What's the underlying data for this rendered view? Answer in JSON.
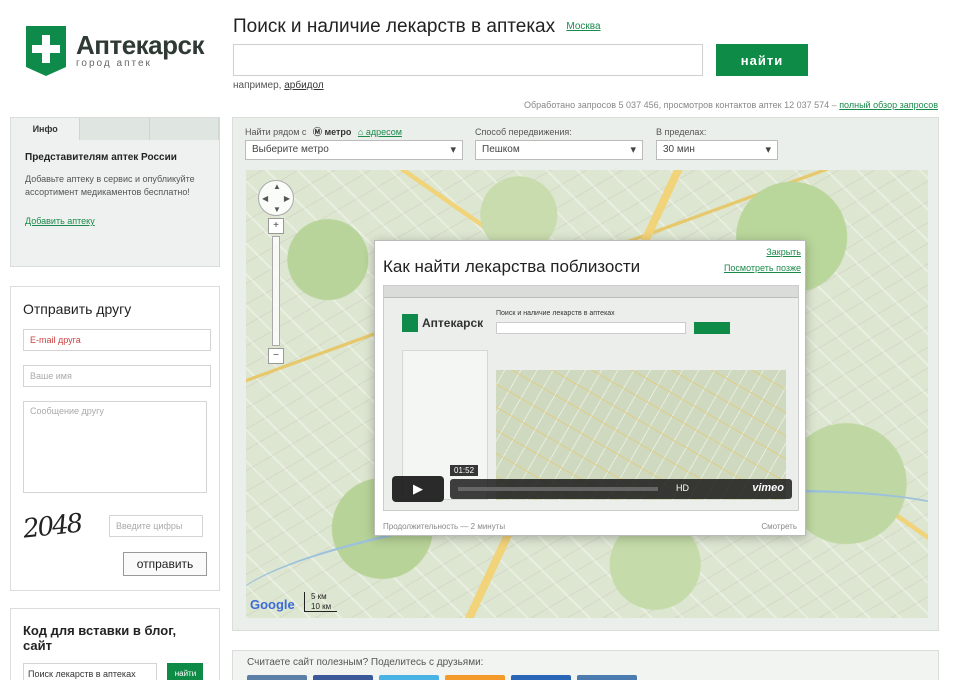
{
  "header": {
    "logo_name": "Аптекарск",
    "logo_sub": "город аптек",
    "search_title": "Поиск и наличие лекарств в аптеках",
    "city": "Москва",
    "search_value": "",
    "search_button": "найти",
    "example": "например,",
    "example_word": "арбидол",
    "stats": "Обработано запросов 5 037 456, просмотров контактов аптек 12 037 574 –",
    "stats_link": "полный обзор запросов"
  },
  "info_panel": {
    "tabs": [
      {
        "label": "Инфо"
      },
      {
        "label": ""
      },
      {
        "label": ""
      }
    ],
    "title": "Представителям аптек России",
    "text": "Добавьте аптеку в сервис и опубликуйте ассортимент медикаментов бесплатно!",
    "link": "Добавить аптеку"
  },
  "send_panel": {
    "title": "Отправить другу",
    "email_placeholder": "E-mail друга",
    "name_placeholder": "Ваше имя",
    "comment_placeholder": "Сообщение другу",
    "captcha": "2048",
    "captcha_placeholder": "Введите цифры",
    "submit": "отправить"
  },
  "blog_panel": {
    "title": "Код для вставки в блог, сайт",
    "input_value": "Поиск лекарств в аптеках",
    "button": "найти"
  },
  "filters": {
    "near_label": "Найти рядом с",
    "metro": "метро",
    "address": "адресом",
    "metro_select": "Выберите метро",
    "transport_label": "Способ передвижения:",
    "transport_select": "Пешком",
    "time_label": "В пределах:",
    "time_select": "30 мин"
  },
  "map": {
    "zoom_in": "+",
    "zoom_out": "−",
    "google": "Google",
    "scale_top": "5 км",
    "scale_bottom": "10 км"
  },
  "popup": {
    "title": "Как найти лекарства поблизости",
    "close": "Закрыть",
    "view": "Посмотреть позже",
    "video_logo": "Аптекарск",
    "video_search_title": "Поиск и наличие лекарств в аптеках",
    "time": "01:52",
    "hd": "HD",
    "vimeo": "vimeo",
    "foot_left": "Продолжительность — 2 минуты",
    "foot_right": "Смотреть"
  },
  "share": {
    "text": "Считаете сайт полезным? Поделитесь с друзьями:",
    "icons": [
      {
        "name": "vk-icon",
        "color": "#5b7fa6"
      },
      {
        "name": "facebook-icon",
        "color": "#3b5998"
      },
      {
        "name": "twitter-icon",
        "color": "#4ab3e6"
      },
      {
        "name": "odnoklassniki-icon",
        "color": "#f39a2a"
      },
      {
        "name": "mailru-icon",
        "color": "#2a66b8"
      },
      {
        "name": "livejournal-icon",
        "color": "#4c7bb0"
      }
    ]
  },
  "colors": {
    "brand_green": "#0f8b48",
    "link_green": "#1a8a4a"
  }
}
